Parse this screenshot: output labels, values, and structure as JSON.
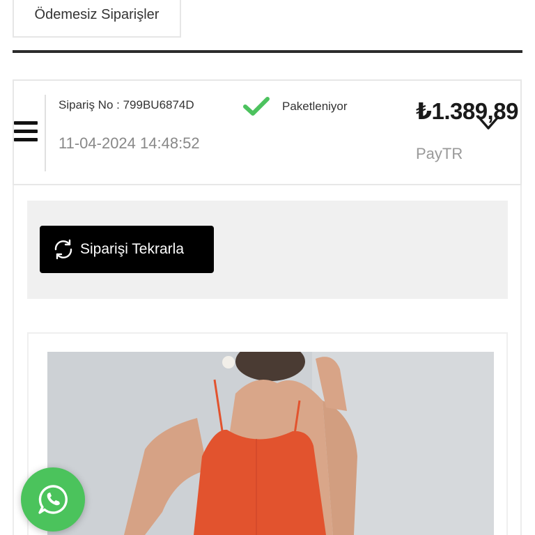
{
  "tabs": {
    "unpaid_orders_label": "Ödemesiz Siparişler"
  },
  "order": {
    "number_text": "Sipariş No : 799BU6874D",
    "date": "11-04-2024 14:48:52",
    "status": "Paketleniyor",
    "total": "₺1.389,89",
    "payment_method": "PayTR"
  },
  "actions": {
    "reorder_label": "Siparişi Tekrarla"
  },
  "icons": {
    "menu": "hamburger-menu-icon",
    "status": "check-icon",
    "expand": "chevron-down-icon",
    "reorder": "refresh-icon",
    "chat": "whatsapp-icon"
  },
  "colors": {
    "status_check": "#4cc25e",
    "reorder_button_bg": "#000000",
    "whatsapp_bg": "#4bc35c",
    "product_dress": "#e2532e"
  }
}
